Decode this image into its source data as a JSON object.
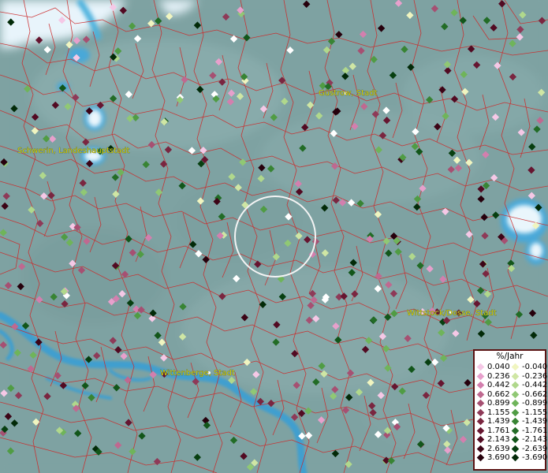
{
  "cities": [
    {
      "name": "Schwerin, Landeshauptstadt"
    },
    {
      "name": "Güstrow, Stadt"
    },
    {
      "name": "Wittstock/Dosse, Stadt"
    },
    {
      "name": "Wittenberge, Stadt"
    }
  ],
  "legend": {
    "title": "%/Jahr",
    "positive": [
      {
        "value": "0.040",
        "color": "#f5c8e6"
      },
      {
        "value": "0.236",
        "color": "#e7a0cc"
      },
      {
        "value": "0.442",
        "color": "#d37fae"
      },
      {
        "value": "0.662",
        "color": "#bf6990"
      },
      {
        "value": "0.899",
        "color": "#a65072"
      },
      {
        "value": "1.155",
        "color": "#8e3a58"
      },
      {
        "value": "1.439",
        "color": "#7a2640"
      },
      {
        "value": "1.761",
        "color": "#661530"
      },
      {
        "value": "2.143",
        "color": "#520a22"
      },
      {
        "value": "2.639",
        "color": "#3c0416"
      },
      {
        "value": "3.690",
        "color": "#26000c"
      }
    ],
    "negative": [
      {
        "value": "-0.040",
        "color": "#f0f5c0"
      },
      {
        "value": "-0.236",
        "color": "#cfe6a4"
      },
      {
        "value": "-0.442",
        "color": "#b0d88c"
      },
      {
        "value": "-0.662",
        "color": "#90c874"
      },
      {
        "value": "-0.899",
        "color": "#6fb45a"
      },
      {
        "value": "-1.155",
        "color": "#509c44"
      },
      {
        "value": "-1.439",
        "color": "#388434"
      },
      {
        "value": "-1.761",
        "color": "#226c26"
      },
      {
        "value": "-2.143",
        "color": "#12561a"
      },
      {
        "value": "-2.639",
        "color": "#073f10"
      },
      {
        "value": "-3.690",
        "color": "#022a08"
      }
    ]
  },
  "colors": {
    "background": "#7fa3a3",
    "water": "#3f9fcf",
    "border": "#cc2a2a",
    "label": "#d8d000",
    "white_point": "#ffffff"
  }
}
